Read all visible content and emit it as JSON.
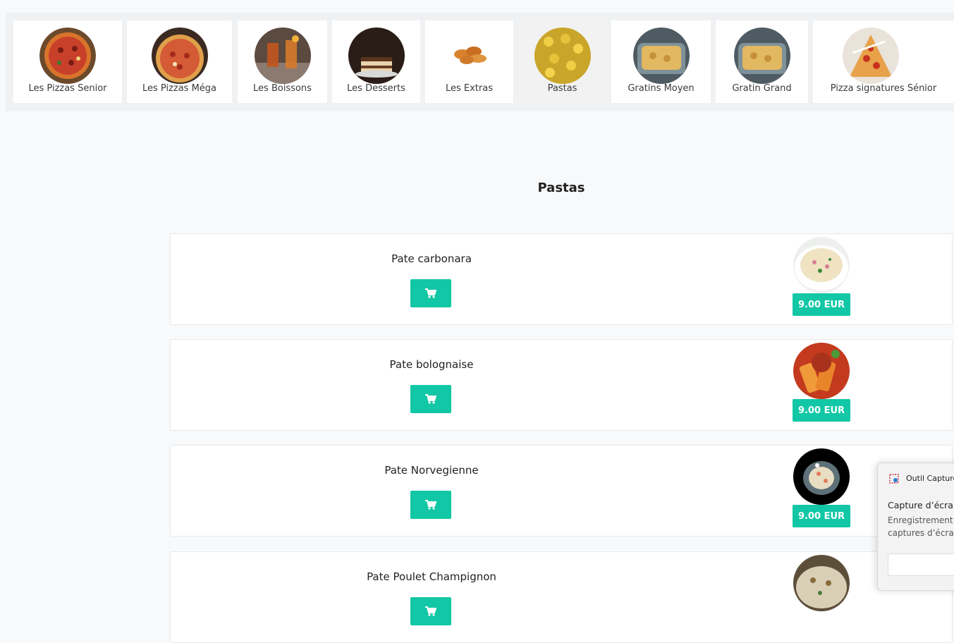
{
  "categories": [
    {
      "label": "Les Pizzas Senior",
      "icon": "pizza-senior-photo"
    },
    {
      "label": "Les Pizzas Méga",
      "icon": "pizza-mega-photo"
    },
    {
      "label": "Les Boissons",
      "icon": "drinks-photo"
    },
    {
      "label": "Les Desserts",
      "icon": "dessert-photo"
    },
    {
      "label": "Les Extras",
      "icon": "extras-photo"
    },
    {
      "label": "Pastas",
      "icon": "pasta-photo",
      "active": true
    },
    {
      "label": "Gratins Moyen",
      "icon": "gratin-photo"
    },
    {
      "label": "Gratin Grand",
      "icon": "gratin-photo"
    },
    {
      "label": "Pizza signatures Sénior",
      "icon": "pizza-signature-photo"
    }
  ],
  "section": {
    "title": "Pastas"
  },
  "products": [
    {
      "name": "Pate carbonara",
      "price": "9.00 EUR"
    },
    {
      "name": "Pate bolognaise",
      "price": "9.00 EUR"
    },
    {
      "name": "Pate Norvegienne",
      "price": "9.00 EUR"
    },
    {
      "name": "Pate Poulet Champignon",
      "price": ""
    }
  ],
  "toast": {
    "app": "Outil Capture",
    "title": "Capture d’écran",
    "body_line1": "Enregistrement",
    "body_line2": "captures d’écra"
  },
  "colors": {
    "accent": "#12c7a5",
    "background": "#f8f9fb"
  }
}
